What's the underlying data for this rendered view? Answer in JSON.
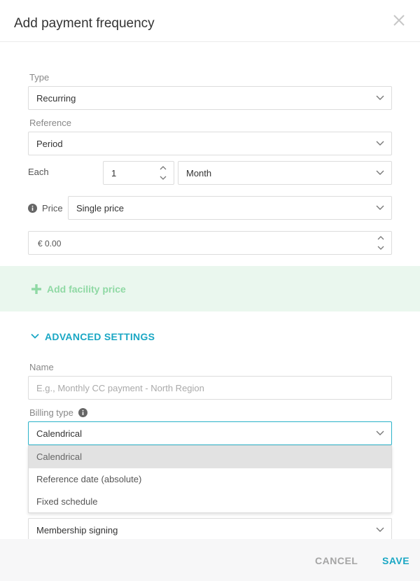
{
  "dialog": {
    "title": "Add payment frequency"
  },
  "type": {
    "label": "Type",
    "value": "Recurring"
  },
  "reference": {
    "label": "Reference",
    "value": "Period"
  },
  "each": {
    "label": "Each",
    "number": "1",
    "unit": "Month"
  },
  "price": {
    "label": "Price",
    "value": "Single price",
    "amount": "€ 0.00"
  },
  "facility": {
    "add_label": "Add facility price",
    "accent": "#8fd9a4"
  },
  "advanced": {
    "label": "ADVANCED SETTINGS",
    "accent": "#1aa7c4"
  },
  "name": {
    "label": "Name",
    "placeholder": "E.g., Monthly CC payment - North Region"
  },
  "billing_type": {
    "label": "Billing type",
    "value": "Calendrical",
    "options": [
      "Calendrical",
      "Reference date (absolute)",
      "Fixed schedule"
    ]
  },
  "hidden_field": {
    "value": "Membership signing"
  },
  "footer": {
    "cancel_label": "CANCEL",
    "save_label": "SAVE"
  },
  "icons": {
    "close": "close-icon",
    "chevron": "chevron-down-icon",
    "info": "info-icon",
    "plus": "plus-icon",
    "spinner": "spinner-arrows-icon"
  }
}
